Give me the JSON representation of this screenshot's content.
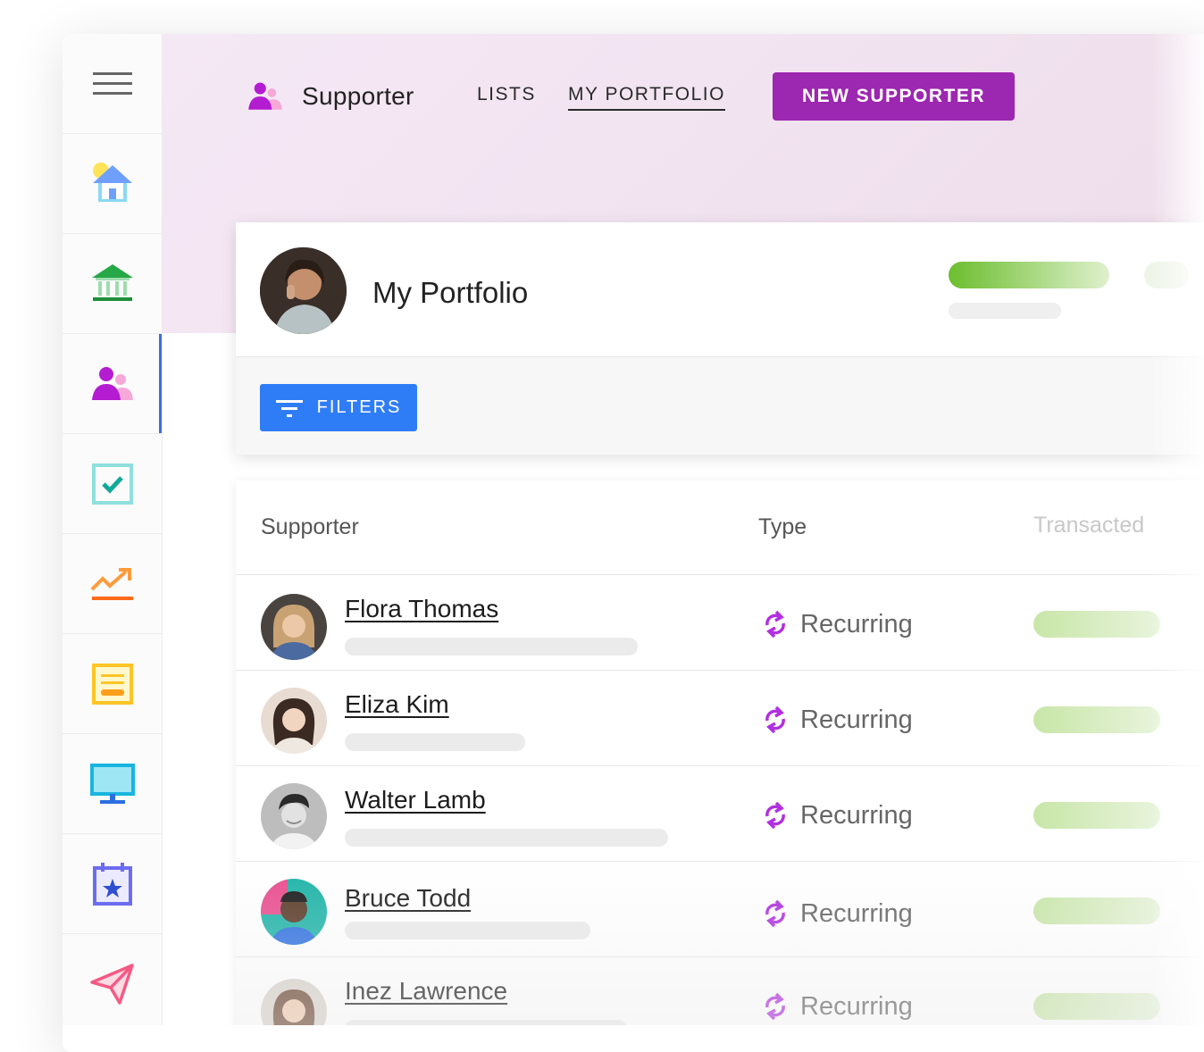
{
  "app": {
    "brand_title": "Supporter",
    "nav_tabs": [
      "LISTS",
      "MY PORTFOLIO"
    ],
    "active_tab": "MY PORTFOLIO",
    "new_button_label": "NEW SUPPORTER"
  },
  "sidebar": {
    "items": [
      {
        "icon": "menu-icon"
      },
      {
        "icon": "home-icon"
      },
      {
        "icon": "bank-icon"
      },
      {
        "icon": "people-icon",
        "active": true
      },
      {
        "icon": "checkbox-icon"
      },
      {
        "icon": "trending-up-icon"
      },
      {
        "icon": "document-icon"
      },
      {
        "icon": "monitor-icon"
      },
      {
        "icon": "calendar-star-icon"
      },
      {
        "icon": "send-icon"
      }
    ],
    "active_color": "#3b6fe0"
  },
  "portfolio": {
    "title": "My Portfolio",
    "filters_label": "FILTERS"
  },
  "table": {
    "headers": [
      "Supporter",
      "Type",
      "Transacted"
    ],
    "rows": [
      {
        "name": "Flora Thomas",
        "type": "Recurring"
      },
      {
        "name": "Eliza Kim",
        "type": "Recurring"
      },
      {
        "name": "Walter Lamb",
        "type": "Recurring"
      },
      {
        "name": "Bruce Todd",
        "type": "Recurring"
      },
      {
        "name": "Inez Lawrence",
        "type": "Recurring"
      }
    ]
  },
  "colors": {
    "brand_purple": "#9c27b0",
    "filters_blue": "#2f7df6",
    "recurring_icon": "#b12fe0",
    "progress_green": "#7cc63a"
  }
}
